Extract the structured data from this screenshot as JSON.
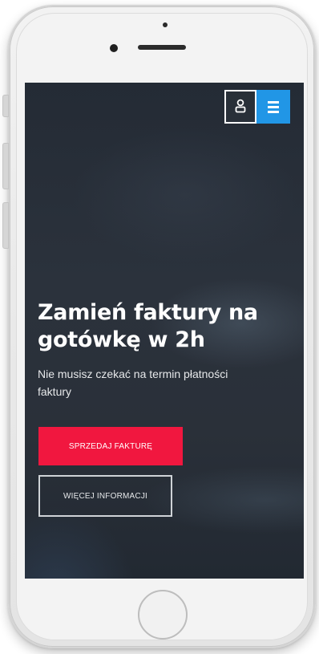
{
  "header": {
    "user_icon": "user-icon",
    "menu_icon": "hamburger-menu-icon",
    "menu_color": "#2196e6"
  },
  "hero": {
    "title_line1": "Zamień faktury na",
    "title_line2": "gotówkę w 2h",
    "subtitle_line1": "Nie musisz czekać na termin płatności",
    "subtitle_line2": "faktury"
  },
  "buttons": {
    "primary_label": "SPRZEDAJ FAKTURĘ",
    "primary_color": "#f1173f",
    "secondary_label": "WIĘCEJ INFORMACJI"
  }
}
